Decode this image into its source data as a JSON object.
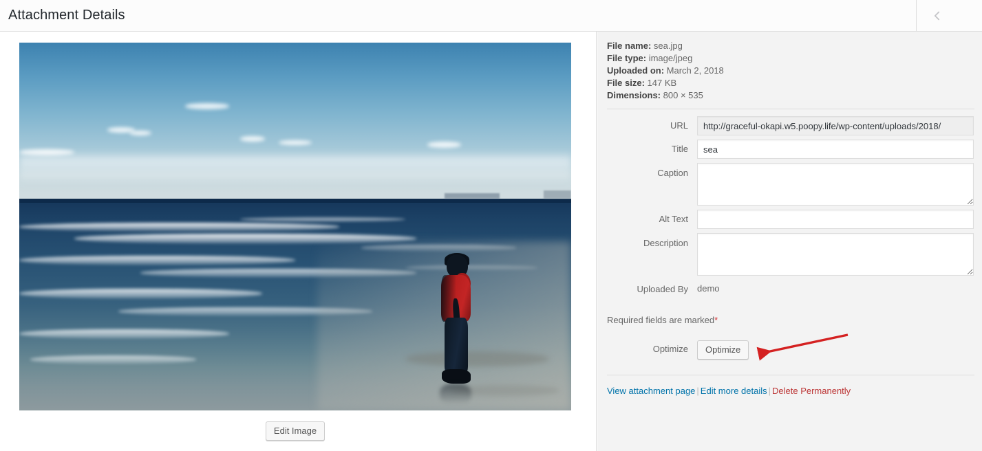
{
  "header": {
    "title": "Attachment Details",
    "prev_icon": "chevron-left-icon"
  },
  "media": {
    "image_alt": "sea.jpg - boy standing at the shoreline of the ocean",
    "edit_image_label": "Edit Image"
  },
  "details": {
    "file_name_label": "File name:",
    "file_name_value": "sea.jpg",
    "file_type_label": "File type:",
    "file_type_value": "image/jpeg",
    "uploaded_on_label": "Uploaded on:",
    "uploaded_on_value": "March 2, 2018",
    "file_size_label": "File size:",
    "file_size_value": "147 KB",
    "dimensions_label": "Dimensions:",
    "dimensions_value": "800 × 535"
  },
  "form": {
    "url_label": "URL",
    "url_value": "http://graceful-okapi.w5.poopy.life/wp-content/uploads/2018/",
    "title_label": "Title",
    "title_value": "sea",
    "caption_label": "Caption",
    "caption_value": "",
    "alt_text_label": "Alt Text",
    "alt_text_value": "",
    "description_label": "Description",
    "description_value": "",
    "uploaded_by_label": "Uploaded By",
    "uploaded_by_value": "demo",
    "required_note": "Required fields are marked",
    "required_star": "*",
    "optimize_label": "Optimize",
    "optimize_button": "Optimize"
  },
  "actions": {
    "view_attachment": "View attachment page",
    "separator": "|",
    "edit_more_details": "Edit more details",
    "delete_permanently": "Delete Permanently"
  },
  "annotation": {
    "arrow": "red-arrow-pointing-to-optimize-button",
    "color": "#d42121"
  },
  "colors": {
    "link": "#0073aa",
    "delete_link": "#bc3636",
    "sidebar_bg": "#f3f3f3",
    "header_bg": "#fcfcfc",
    "border": "#dddddd",
    "required_star": "#d63638"
  }
}
